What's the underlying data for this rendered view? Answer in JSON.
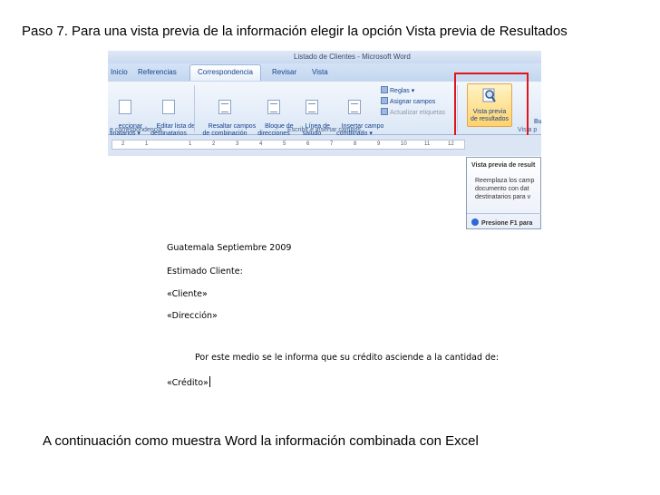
{
  "captions": {
    "top": "Paso 7. Para una vista previa de la información elegir la opción Vista previa de Resultados",
    "bottom": "A continuación como muestra Word la información combinada con Excel"
  },
  "window": {
    "title": "Listado de Clientes - Microsoft Word"
  },
  "ribbon": {
    "tabs": [
      "Inicio",
      "Referencias",
      "Correspondencia",
      "Revisar",
      "Vista"
    ],
    "active_tab": "Correspondencia",
    "buttons": {
      "select_recipients": "eccionar\ntinatarios ▾",
      "edit_list": "Editar lista de\ndestinatarios",
      "highlight_fields": "Resaltar campos\nde combinación",
      "address_block": "Bloque de\ndirecciones",
      "greeting_line": "Línea de\nsaludo",
      "insert_field": "Insertar campo\ncombinado ▾",
      "preview_results": "Vista previa\nde resultados"
    },
    "small_commands": {
      "rules": "Reglas ▾",
      "match_fields": "Asignar campos",
      "update_labels": "Actualizar etiquetas"
    },
    "group_labels": {
      "start": "e correspondencia",
      "write_insert": "Escribir e insertar campos",
      "preview": "Vista p"
    },
    "right_col": [
      "Bu",
      "Co"
    ]
  },
  "ruler": {
    "ticks": [
      "2",
      "1",
      "1",
      "2",
      "3",
      "4",
      "5",
      "6",
      "7",
      "8",
      "9",
      "10",
      "11",
      "12"
    ]
  },
  "tooltip": {
    "title": "Vista previa de result",
    "body": [
      "Reemplaza los camp",
      "documento con dat",
      "destinatarios para v"
    ],
    "help": "Presione F1 para"
  },
  "letter": {
    "date": "Guatemala Septiembre 2009",
    "greeting": "Estimado Cliente:",
    "client_field": "«Cliente»",
    "address_field": "«Dirección»",
    "body": "Por este medio se le informa que su crédito asciende a la cantidad de:",
    "credit_field": "«Crédito»"
  },
  "colors": {
    "highlight_box": "#e0141a",
    "ribbon_text": "#15428b",
    "preview_button": "#ffd36b"
  },
  "icons": [
    "magnifier-icon",
    "help-icon",
    "document-icon"
  ]
}
